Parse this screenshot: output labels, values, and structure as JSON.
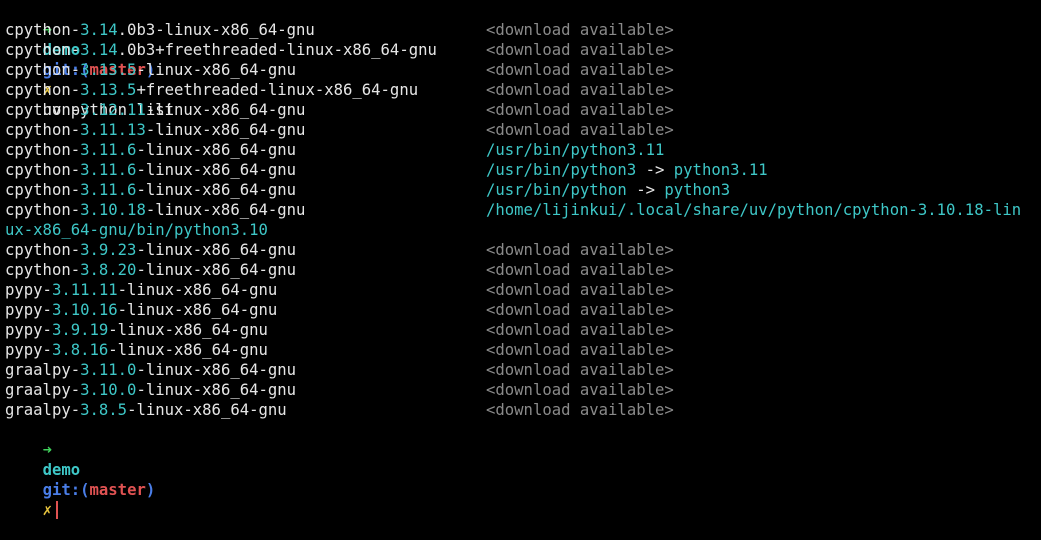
{
  "prompt": {
    "arrow": "➜",
    "dir": "demo",
    "git_open": "git:(",
    "branch": "master",
    "git_close": ")",
    "dirty": "✗",
    "command": "uv python list"
  },
  "rows": [
    {
      "prefix": "cpython-",
      "version": "3.14",
      "rest": ".0b3-linux-x86_64-gnu",
      "status": "<download available>"
    },
    {
      "prefix": "cpython-",
      "version": "3.14",
      "rest": ".0b3+freethreaded-linux-x86_64-gnu",
      "status": "<download available>"
    },
    {
      "prefix": "cpython-",
      "version": "3.13.5",
      "rest": "-linux-x86_64-gnu",
      "status": "<download available>"
    },
    {
      "prefix": "cpython-",
      "version": "3.13.5",
      "rest": "+freethreaded-linux-x86_64-gnu",
      "status": "<download available>"
    },
    {
      "prefix": "cpython-",
      "version": "3.12.11",
      "rest": "-linux-x86_64-gnu",
      "status": "<download available>"
    },
    {
      "prefix": "cpython-",
      "version": "3.11.13",
      "rest": "-linux-x86_64-gnu",
      "status": "<download available>"
    },
    {
      "prefix": "cpython-",
      "version": "3.11.6",
      "rest": "-linux-x86_64-gnu",
      "path": "/usr/bin/python3.11"
    },
    {
      "prefix": "cpython-",
      "version": "3.11.6",
      "rest": "-linux-x86_64-gnu",
      "path": "/usr/bin/python3",
      "link_arrow": "->",
      "link_target": "python3.11"
    },
    {
      "prefix": "cpython-",
      "version": "3.11.6",
      "rest": "-linux-x86_64-gnu",
      "path": "/usr/bin/python",
      "link_arrow": "->",
      "link_target": "python3"
    },
    {
      "prefix": "cpython-",
      "version": "3.10.18",
      "rest": "-linux-x86_64-gnu",
      "path": "/home/lijinkui/.local/share/uv/python/cpython-3.10.18-lin",
      "wrap": "ux-x86_64-gnu/bin/python3.10"
    },
    {
      "prefix": "cpython-",
      "version": "3.9.23",
      "rest": "-linux-x86_64-gnu",
      "status": "<download available>"
    },
    {
      "prefix": "cpython-",
      "version": "3.8.20",
      "rest": "-linux-x86_64-gnu",
      "status": "<download available>"
    },
    {
      "prefix": "pypy-",
      "version": "3.11.11",
      "rest": "-linux-x86_64-gnu",
      "status": "<download available>"
    },
    {
      "prefix": "pypy-",
      "version": "3.10.16",
      "rest": "-linux-x86_64-gnu",
      "status": "<download available>"
    },
    {
      "prefix": "pypy-",
      "version": "3.9.19",
      "rest": "-linux-x86_64-gnu",
      "status": "<download available>"
    },
    {
      "prefix": "pypy-",
      "version": "3.8.16",
      "rest": "-linux-x86_64-gnu",
      "status": "<download available>"
    },
    {
      "prefix": "graalpy-",
      "version": "3.11.0",
      "rest": "-linux-x86_64-gnu",
      "status": "<download available>"
    },
    {
      "prefix": "graalpy-",
      "version": "3.10.0",
      "rest": "-linux-x86_64-gnu",
      "status": "<download available>"
    },
    {
      "prefix": "graalpy-",
      "version": "3.8.5",
      "rest": "-linux-x86_64-gnu",
      "status": "<download available>"
    }
  ],
  "colors": {
    "background": "#000000",
    "foreground": "#e6e6e6",
    "cyan": "#3ec7c7",
    "green": "#3fd15b",
    "blue": "#4a7ee8",
    "red": "#e05252",
    "yellow": "#e8c53e",
    "grey": "#8a8a8a"
  }
}
